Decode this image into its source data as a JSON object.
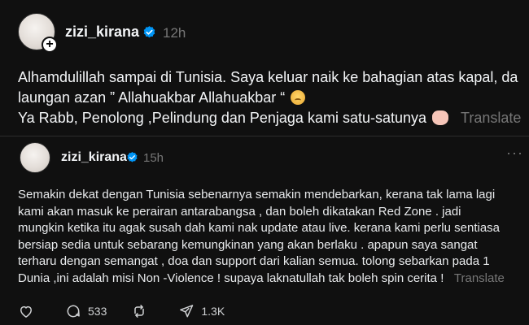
{
  "post1": {
    "username": "zizi_kirana",
    "time": "12h",
    "lines": [
      "Alhamdulillah sampai di Tunisia. Saya keluar naik ke bahagian atas kapal, da",
      "laungan azan ” Allahuakbar Allahuakbar “",
      "Ya Rabb, Penolong ,Pelindung dan Penjaga kami satu-satunya"
    ],
    "translate_label": "Translate"
  },
  "post2": {
    "username": "zizi_kirana",
    "time": "15h",
    "lines": [
      "Semakin dekat dengan Tunisia sebenarnya semakin mendebarkan, kerana tak lama lagi",
      "kami akan masuk ke perairan antarabangsa , dan boleh dikatakan Red Zone . jadi",
      "mungkin ketika itu agak susah dah kami nak update atau live. kerana kami perlu sentiasa",
      "bersiap sedia untuk sebarang kemungkinan yang akan berlaku . apapun saya sangat",
      "terharu dengan semangat , doa dan support dari kalian semua. tolong sebarkan pada 1",
      "Dunia ,ini adalah misi Non -Violence ! supaya laknatullah tak boleh spin cerita !"
    ],
    "translate_label": "Translate",
    "actions": {
      "like_count": "",
      "reply_count": "533",
      "repost_count": "",
      "share_count": "1.3K"
    }
  },
  "icons": {
    "verified": "verified-badge-icon",
    "more": "more-icon",
    "like": "heart-icon",
    "reply": "comment-icon",
    "repost": "repost-icon",
    "share": "send-icon"
  },
  "colors": {
    "background": "#101010",
    "verified": "#0095f6",
    "muted": "#777777"
  }
}
